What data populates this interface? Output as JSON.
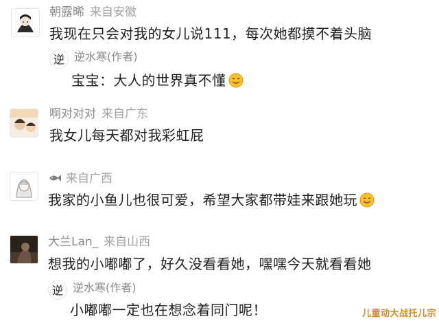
{
  "comments": [
    {
      "username": "朝露晞",
      "location": "来自安徽",
      "text": "我现在只会对我的女儿说111，每次她都摸不着头脑",
      "reply": {
        "author": "逆水寒(作者)",
        "text": "宝宝：大人的世界真不懂",
        "emoji": "smile-emoji"
      }
    },
    {
      "username": "啊对对对",
      "location": "来自广东",
      "text": "我女儿每天都对我彩虹屁"
    },
    {
      "username": "",
      "username_icon": "fish-icon",
      "location": "来自广西",
      "text": "我家的小鱼儿也很可爱，希望大家都带娃来跟她玩",
      "emoji": "smile-emoji"
    },
    {
      "username": "大兰Lan_",
      "location": "来自山西",
      "text": "想我的小嘟嘟了，好久没看看她，嘿嘿今天就看看她",
      "reply": {
        "author": "逆水寒(作者)",
        "text": "小嘟嘟一定也在想念着同门呢！"
      }
    }
  ],
  "watermark": "儿童动大战托儿宗",
  "colors": {
    "username": "#8a8a8a",
    "location": "#a3a3a3",
    "text": "#1f1f1f",
    "reply_bg": "#f3f3f3",
    "watermark": "#d58a1d"
  }
}
